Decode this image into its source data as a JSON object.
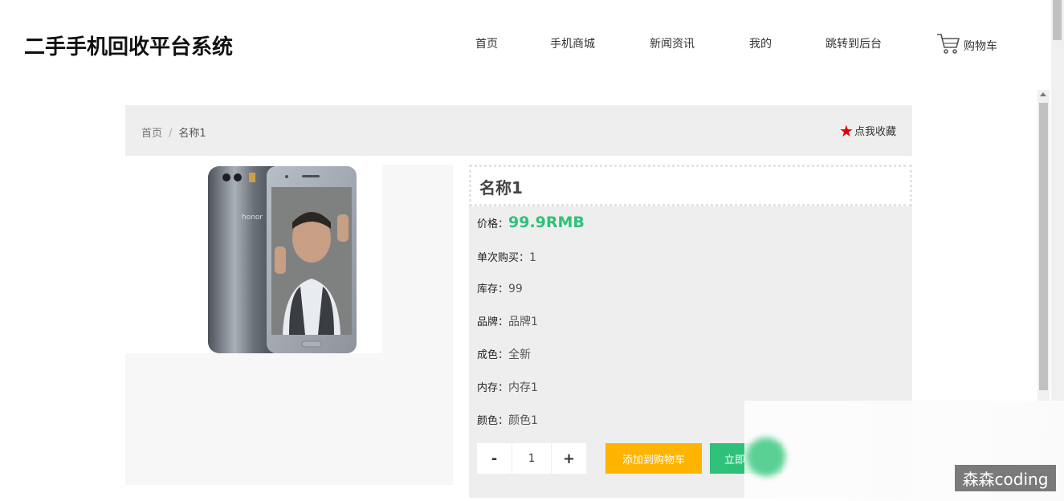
{
  "site": {
    "title": "二手手机回收平台系统"
  },
  "nav": {
    "items": [
      {
        "label": "首页"
      },
      {
        "label": "手机商城"
      },
      {
        "label": "新闻资讯"
      },
      {
        "label": "我的"
      },
      {
        "label": "跳转到后台"
      }
    ],
    "cart_label": "购物车"
  },
  "breadcrumb": {
    "home": "首页",
    "separator": "/",
    "current": "名称1"
  },
  "favorite": {
    "label": "点我收藏",
    "icon": "star-icon"
  },
  "product": {
    "name": "名称1",
    "price_label": "价格：",
    "price_value": "99.9RMB",
    "min_buy_label": "单次购买：",
    "min_buy_value": "1",
    "stock_label": "库存：",
    "stock_value": "99",
    "brand_label": "品牌：",
    "brand_value": "品牌1",
    "condition_label": "成色：",
    "condition_value": "全新",
    "storage_label": "内存：",
    "storage_value": "内存1",
    "color_label": "颜色：",
    "color_value": "颜色1"
  },
  "purchase": {
    "minus": "-",
    "quantity": "1",
    "plus": "+",
    "add_to_cart": "添加到购物车",
    "buy_now": "立即"
  },
  "watermark": "森森coding",
  "colors": {
    "price": "#2fc17a",
    "add_to_cart_bg": "#ffb400",
    "buy_now_bg": "#2fc17a",
    "favorite_star": "#e60000"
  }
}
